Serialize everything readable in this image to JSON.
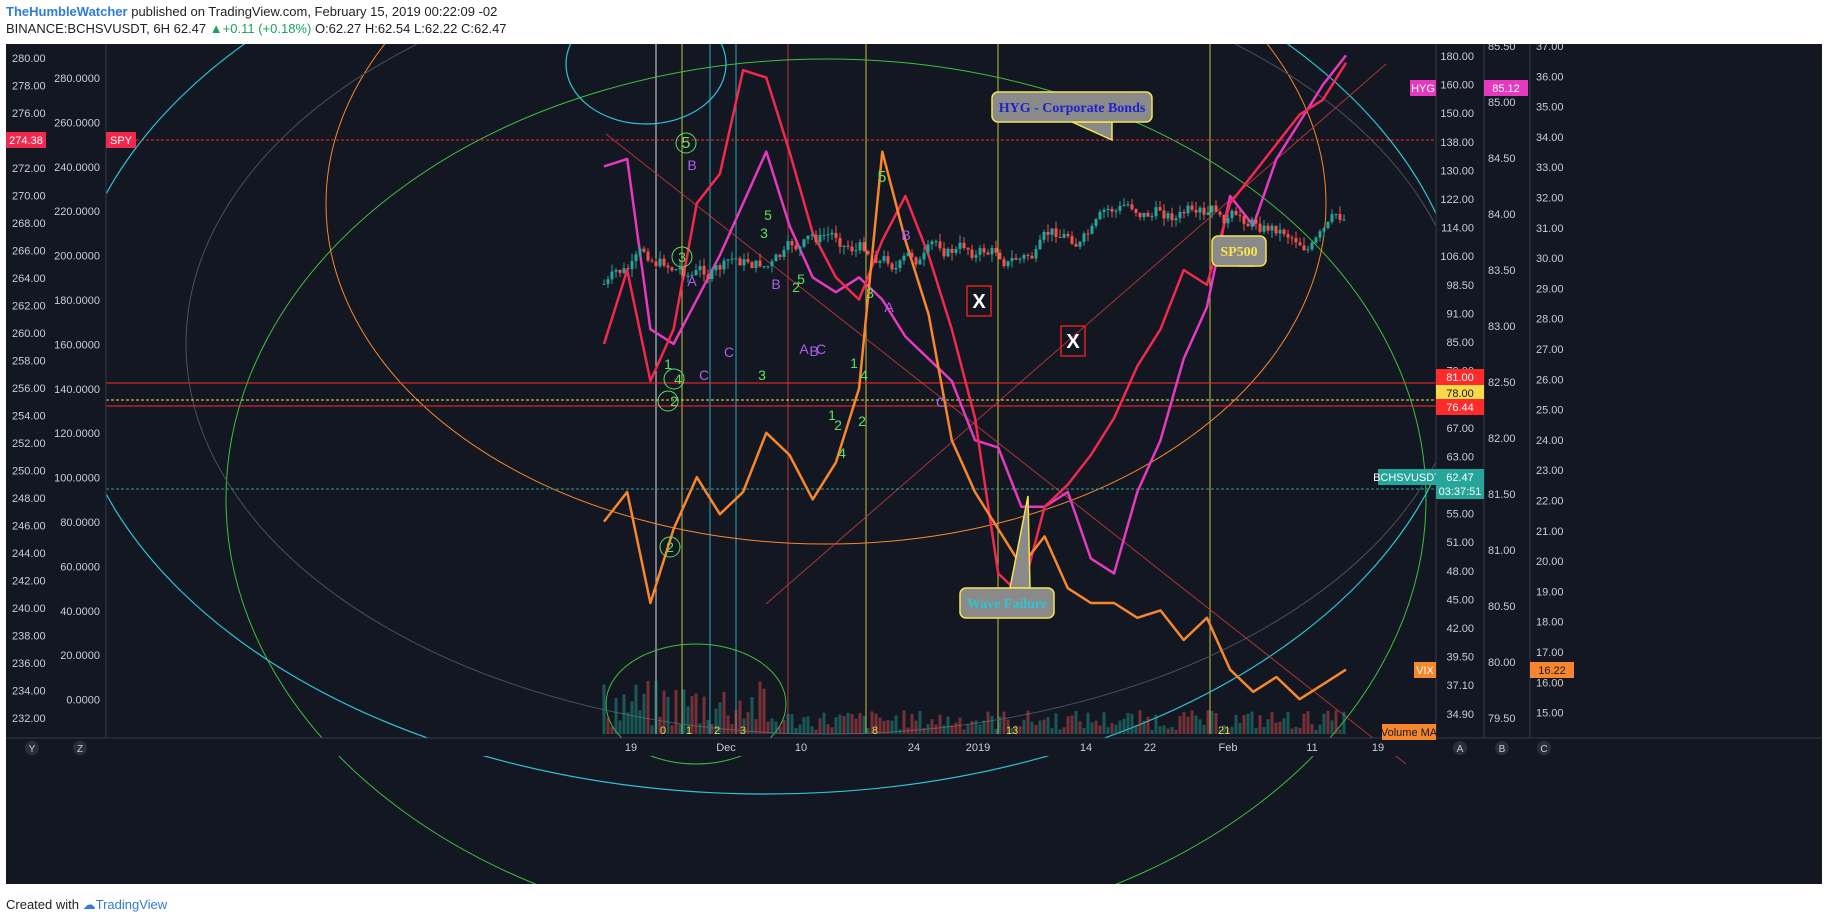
{
  "header": {
    "author": "TheHumbleWatcher",
    "published_text": "published on TradingView.com, February 15, 2019 00:22:09 -02",
    "symbol": "BINANCE:BCHSVUSDT, 6H",
    "last": "62.47",
    "change": "+0.11 (+0.18%)",
    "ohlc_o": "O:62.27",
    "ohlc_h": "H:62.54",
    "ohlc_l": "L:62.22",
    "ohlc_c": "C:62.47"
  },
  "footer": {
    "created_with": "Created with",
    "brand": "TradingView"
  },
  "colors": {
    "background": "#131722",
    "hyg": "#e53ac0",
    "spy": "#f2294e",
    "vix": "#f7872d",
    "price": "#26a69a",
    "green_line": "#3fbf3f",
    "cyan_line": "#2ec4d6",
    "yellow_line": "#e6d84a"
  },
  "chart_data": {
    "type": "line",
    "x_tick_labels": [
      "19",
      "Dec",
      "10",
      "24",
      "2019",
      "14",
      "22",
      "Feb",
      "11",
      "19"
    ],
    "axis_spy": [
      "280.00",
      "278.00",
      "276.00",
      "274.00",
      "272.00",
      "270.00",
      "268.00",
      "266.00",
      "264.00",
      "262.00",
      "260.00",
      "258.00",
      "256.00",
      "254.00",
      "252.00",
      "250.00",
      "248.00",
      "246.00",
      "244.00",
      "242.00",
      "240.00",
      "238.00",
      "236.00",
      "234.00",
      "232.00"
    ],
    "axis_price_left": [
      "280.0000",
      "260.0000",
      "240.0000",
      "220.0000",
      "200.0000",
      "180.0000",
      "160.0000",
      "140.0000",
      "120.0000",
      "100.0000",
      "80.0000",
      "60.0000",
      "40.0000",
      "20.0000",
      "0.0000"
    ],
    "axis_vix": [
      "180.00",
      "160.00",
      "150.00",
      "138.00",
      "130.00",
      "122.00",
      "114.00",
      "106.00",
      "98.50",
      "91.00",
      "85.00",
      "79.00",
      "73.00",
      "67.00",
      "63.00",
      "59.00",
      "55.00",
      "51.00",
      "48.00",
      "45.00",
      "42.00",
      "39.50",
      "37.10",
      "34.90"
    ],
    "axis_hyg": [
      "85.50",
      "85.00",
      "84.50",
      "84.00",
      "83.50",
      "83.00",
      "82.50",
      "82.00",
      "81.50",
      "81.00",
      "80.50",
      "80.00",
      "79.50"
    ],
    "axis_right": [
      "37.00",
      "36.00",
      "35.00",
      "34.00",
      "33.00",
      "32.00",
      "31.00",
      "30.00",
      "29.00",
      "28.00",
      "27.00",
      "26.00",
      "25.00",
      "24.00",
      "23.00",
      "22.00",
      "21.00",
      "20.00",
      "19.00",
      "18.00",
      "17.00",
      "16.00",
      "15.00"
    ],
    "price_tags": {
      "spy": {
        "name": "SPY",
        "value": "274.38"
      },
      "hyg": {
        "name": "HYG",
        "value": "85.12"
      },
      "vix": {
        "name": "VIX",
        "value": "16.22"
      },
      "bchsv": {
        "name": "BCHSVUSDT",
        "value": "62.47",
        "countdown": "03:37:51"
      },
      "h1": "81.00",
      "h2": "78.00",
      "h3": "76.44",
      "volume_ma": "Volume MA"
    },
    "series": [
      {
        "name": "HYG",
        "values": [
          148,
          150,
          104,
          100,
          112,
          124,
          138,
          152,
          132,
          118,
          114,
          118,
          112,
          102,
          96,
          90,
          74,
          72,
          56,
          56,
          60,
          42,
          38,
          60,
          74,
          96,
          110,
          140,
          132,
          150,
          160,
          170,
          178
        ]
      },
      {
        "name": "SPY",
        "values": [
          100,
          120,
          90,
          104,
          138,
          146,
          174,
          172,
          152,
          130,
          118,
          112,
          128,
          140,
          124,
          104,
          80,
          38,
          32,
          56,
          62,
          70,
          80,
          94,
          104,
          120,
          116,
          138,
          146,
          154,
          162,
          166,
          176
        ]
      },
      {
        "name": "VIX",
        "values": [
          52,
          60,
          30,
          50,
          64,
          54,
          60,
          76,
          70,
          58,
          68,
          88,
          152,
          128,
          108,
          74,
          60,
          50,
          40,
          48,
          34,
          30,
          30,
          26,
          28,
          20,
          26,
          12,
          6,
          10,
          4,
          8,
          12
        ]
      }
    ],
    "annotations": {
      "hyg_callout": "HYG - Corporate Bonds",
      "sp_callout": "SP500",
      "wave_callout": "Wave Failure",
      "x_mark": "X",
      "wave_labels": [
        "5",
        "3",
        "2",
        "1",
        "4",
        "2",
        "5",
        "3",
        "3",
        "2",
        "1",
        "4",
        "2",
        "5",
        "3",
        "1",
        "4",
        "2",
        "5",
        "B",
        "A",
        "C",
        "B",
        "A",
        "C",
        "B",
        "A",
        "C",
        "B",
        "C"
      ],
      "cycle_numbers": [
        "0",
        "1",
        "2",
        "3",
        "8",
        "13",
        "21"
      ]
    },
    "bottom_axis_letters": {
      "left": [
        "Y",
        "Z"
      ],
      "right": [
        "A",
        "B",
        "C"
      ]
    }
  }
}
